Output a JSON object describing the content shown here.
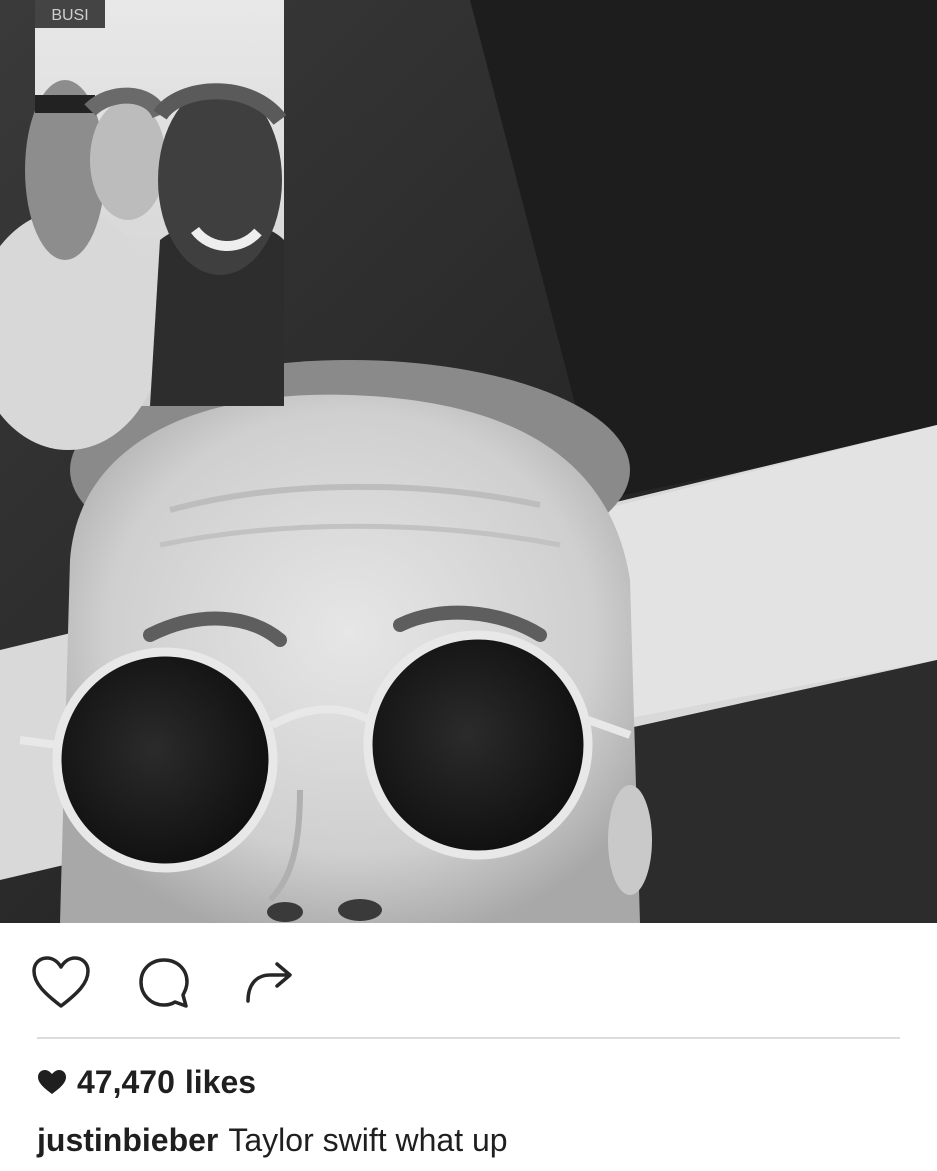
{
  "post": {
    "image_description_icon": "photo",
    "inset_label": "BUSI",
    "likes_count": "47,470",
    "likes_suffix": "likes",
    "username": "justinbieber",
    "caption": "Taylor swift what up"
  },
  "actions": {
    "like_icon": "heart-outline-icon",
    "comment_icon": "comment-bubble-icon",
    "share_icon": "share-arrow-icon",
    "likes_icon": "heart-filled-icon"
  },
  "colors": {
    "text": "#1f1f1f",
    "icon_stroke": "#262626",
    "divider": "#dcdcdc"
  }
}
